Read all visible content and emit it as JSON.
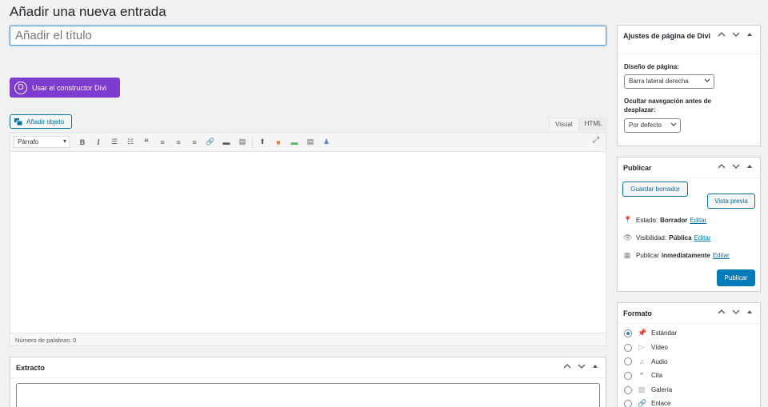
{
  "page": {
    "title": "Añadir una nueva entrada"
  },
  "title_field": {
    "placeholder": "Añadir el título"
  },
  "divi": {
    "button_label": "Usar el constructor Divi",
    "logo_letter": "D"
  },
  "editor": {
    "add_media_label": "Añadir objeto",
    "tabs": [
      "Visual",
      "HTML"
    ],
    "format_select": "Párrafo",
    "word_count": "Número de palabras: 0"
  },
  "excerpt": {
    "title": "Extracto"
  },
  "divi_settings": {
    "title": "Ajustes de página de Divi",
    "layout_label": "Diseño de página:",
    "layout_value": "Barra lateral derecha",
    "hide_nav_label": "Ocultar navegación antes de desplazar:",
    "hide_nav_value": "Por defecto"
  },
  "publish": {
    "title": "Publicar",
    "save_draft": "Guardar borrador",
    "preview": "Vista previa",
    "status_label": "Estado:",
    "status_value": "Borrador",
    "visibility_label": "Visibilidad:",
    "visibility_value": "Pública",
    "schedule_label": "Publicar",
    "schedule_value": "inmediatamente",
    "edit_link": "Editar",
    "publish_button": "Publicar"
  },
  "format": {
    "title": "Formato",
    "options": [
      "Estándar",
      "Vídeo",
      "Audio",
      "Cita",
      "Galería",
      "Enlace"
    ],
    "selected": "Estándar"
  },
  "colors": {
    "accent": "#0071a1",
    "divi": "#7e3bd0",
    "primary": "#007cba"
  }
}
